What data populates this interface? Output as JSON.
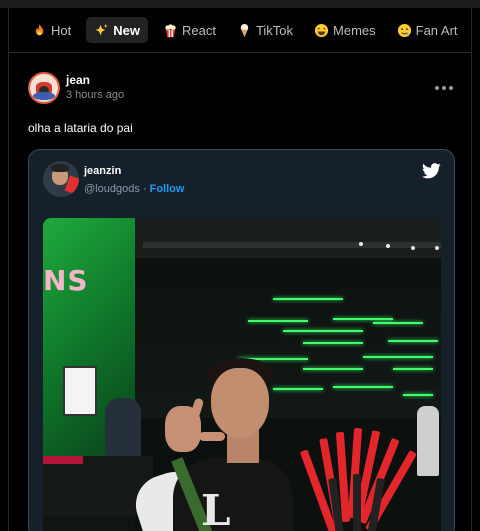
{
  "tabs": [
    {
      "label": "Hot",
      "icon": "fire-icon",
      "active": false
    },
    {
      "label": "New",
      "icon": "sparkles-icon",
      "active": true
    },
    {
      "label": "React",
      "icon": "popcorn-icon",
      "active": false
    },
    {
      "label": "TikTok",
      "icon": "ice-cream-icon",
      "active": false
    },
    {
      "label": "Memes",
      "icon": "laughing-face-icon",
      "active": false
    },
    {
      "label": "Fan Art",
      "icon": "drooling-face-icon",
      "active": false
    }
  ],
  "post": {
    "author": "jean",
    "time": "3 hours ago",
    "caption": "olha a lataria do pai"
  },
  "tweet": {
    "name": "jeanzin",
    "handle": "@loudgods",
    "separator": " · ",
    "follow_label": "Follow",
    "photo_text": "NS"
  },
  "colors": {
    "background": "#000000",
    "tweet_background": "#15202b",
    "link_blue": "#1d9bf0",
    "twitter_blue": "#1d9bf0"
  }
}
